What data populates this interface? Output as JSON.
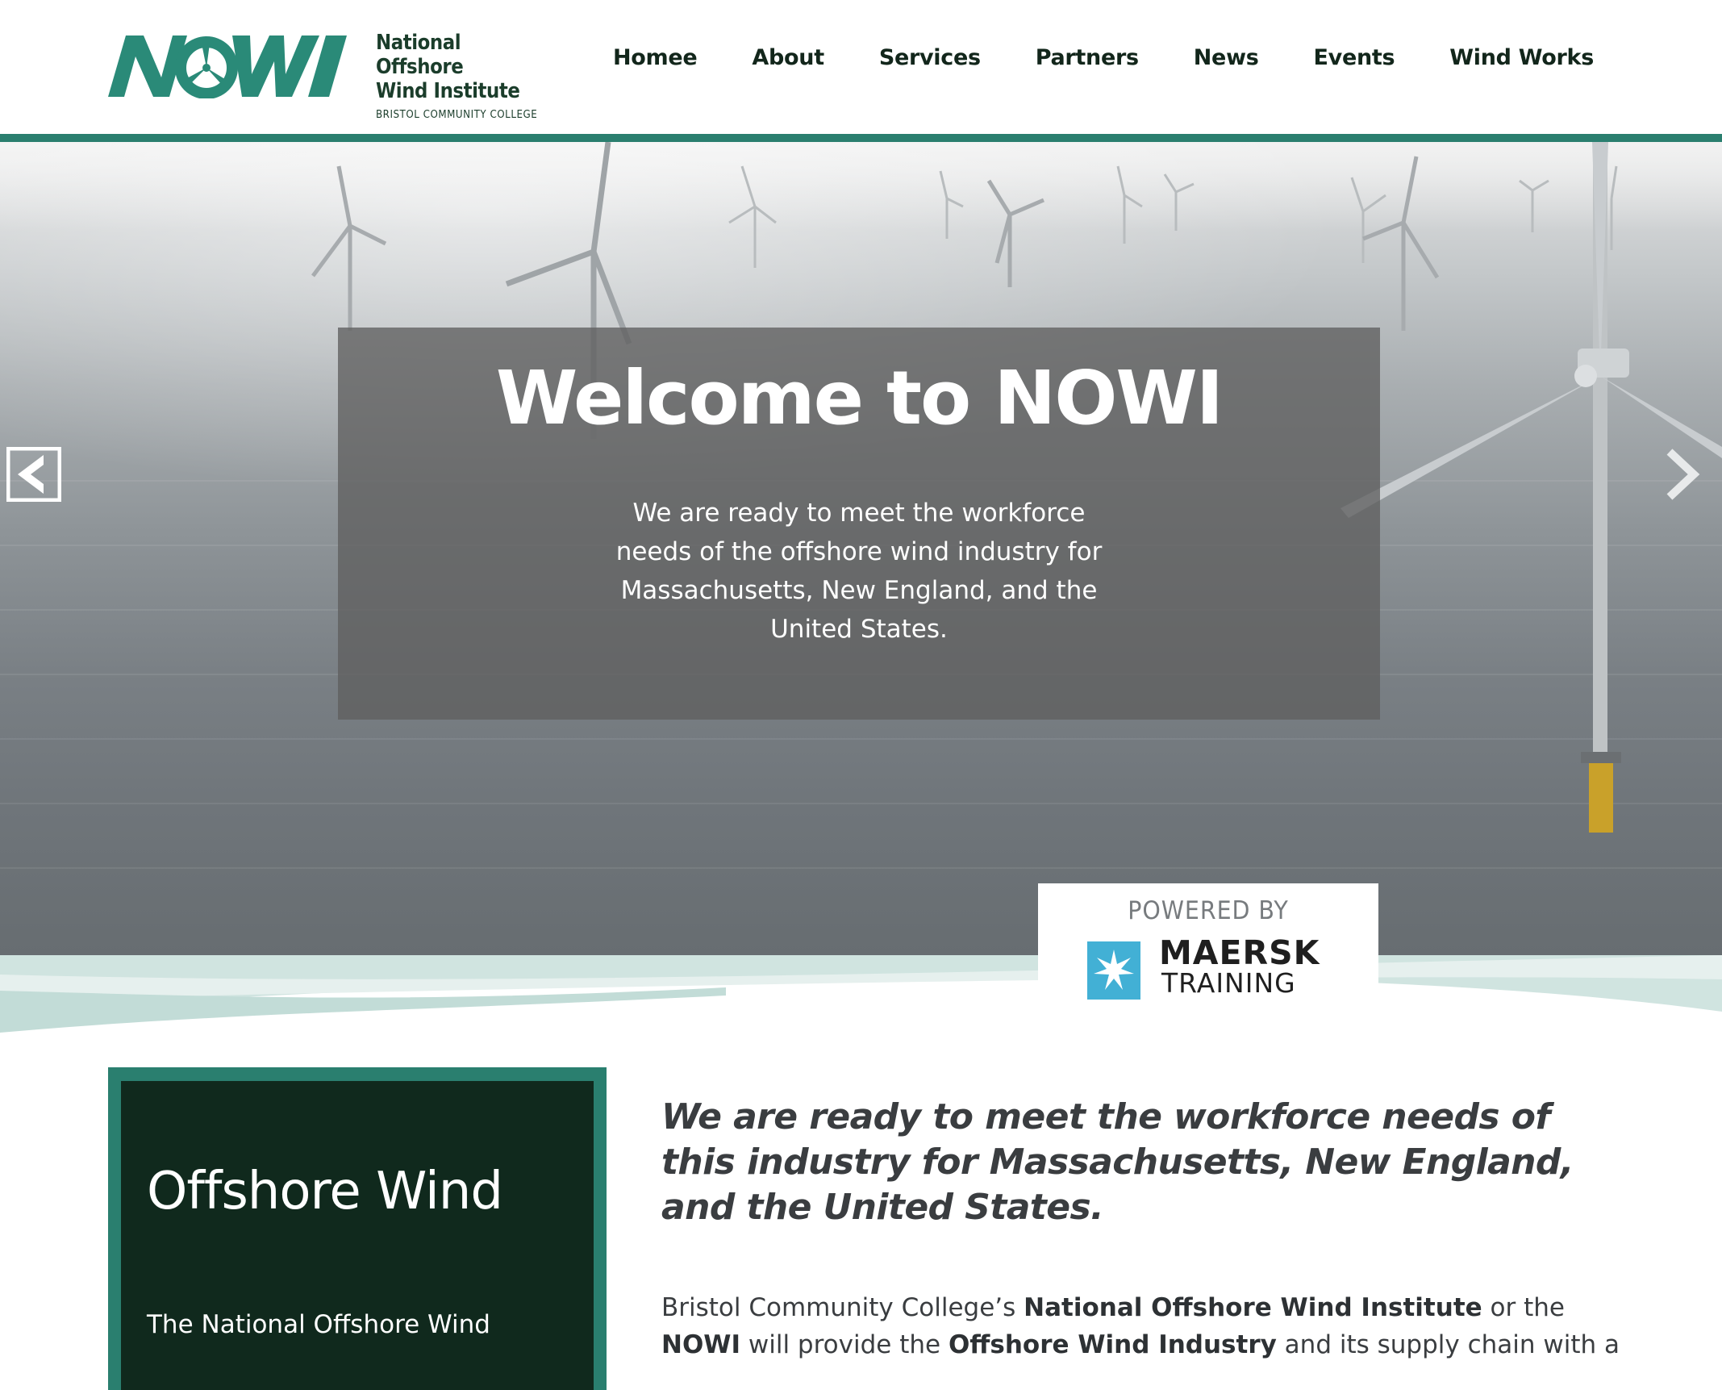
{
  "site": {
    "logo": {
      "mark": "NOWI",
      "line1": "National Offshore",
      "line2": "Wind Institute",
      "line3": "BRISTOL COMMUNITY COLLEGE"
    },
    "nav": [
      {
        "label": "Homee"
      },
      {
        "label": "About"
      },
      {
        "label": "Services"
      },
      {
        "label": "Partners"
      },
      {
        "label": "News"
      },
      {
        "label": "Events"
      },
      {
        "label": "Wind Works"
      }
    ]
  },
  "hero": {
    "title": "Welcome to NOWI",
    "text": "We are ready to meet the workforce needs of the offshore wind industry for Massachusetts, New England, and the United States.",
    "prev_icon": "chevron-left-icon",
    "next_icon": "chevron-right-icon"
  },
  "badge": {
    "powered": "POWERED BY",
    "brand": "MAERSK",
    "sub": "TRAINING"
  },
  "content": {
    "card_title": "Offshore Wind",
    "card_text": "The National Offshore Wind",
    "lead": "We are ready to meet the workforce needs of this industry for Massachusetts, New England, and the United States.",
    "para": {
      "p1": "Bristol Community College’s ",
      "b1": "National Offshore Wind Institute",
      "p2": " or the ",
      "b2": "NOWI",
      "p3": " will provide the ",
      "b3": "Offshore Wind Industry",
      "p4": " and its supply chain with a"
    }
  },
  "colors": {
    "brand_green": "#2a7f6f",
    "dark_green": "#10291d",
    "nav_text": "#12261b",
    "maersk_blue": "#42b0d5"
  }
}
